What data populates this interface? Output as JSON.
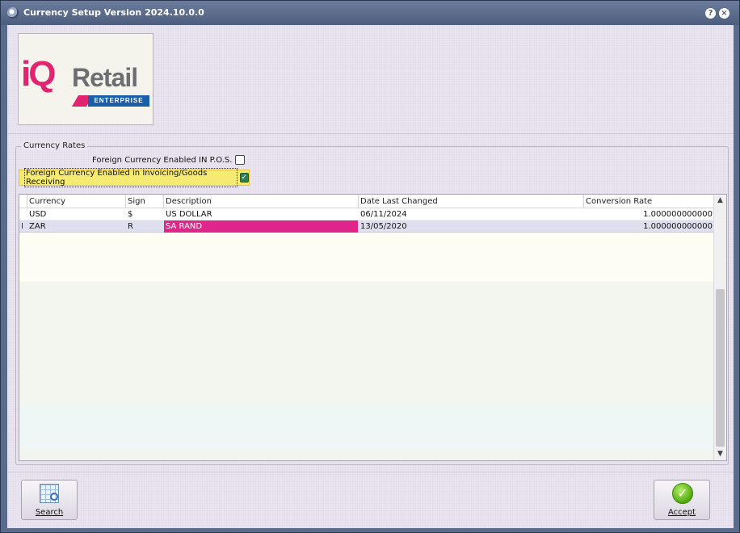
{
  "window": {
    "title": "Currency Setup Version 2024.10.0.0",
    "help_label": "?",
    "close_label": "×"
  },
  "logo": {
    "brand_mark": "iQ",
    "brand_name": "Retail",
    "edition": "ENTERPRISE"
  },
  "currency_rates": {
    "group_title": "Currency Rates",
    "pos_enabled_label": "Foreign Currency Enabled IN P.O.S.",
    "pos_enabled": false,
    "invoicing_enabled_label": "Foreign Currency Enabled in Invoicing/Goods Receiving",
    "invoicing_enabled": true,
    "check_mark": "✓"
  },
  "grid": {
    "columns": [
      "Currency",
      "Sign",
      "Description",
      "Date Last Changed",
      "Conversion Rate"
    ],
    "current_row_marker": "I",
    "rows": [
      {
        "currency": "USD",
        "sign": "$",
        "description": "US DOLLAR",
        "date_last_changed": "06/11/2024",
        "conversion_rate": "1.000000000000"
      },
      {
        "currency": "ZAR",
        "sign": "R",
        "description": "SA RAND",
        "date_last_changed": "13/05/2020",
        "conversion_rate": "1.000000000000"
      }
    ],
    "selected_row": 1,
    "scroll_up": "▲",
    "scroll_down": "▼"
  },
  "buttons": {
    "search_label": "Search",
    "accept_label": "Accept",
    "accept_glyph": "✓"
  },
  "colors": {
    "selected_cell": "#e0268a",
    "highlight": "#f5ea72",
    "accent_green": "#52a80f"
  }
}
